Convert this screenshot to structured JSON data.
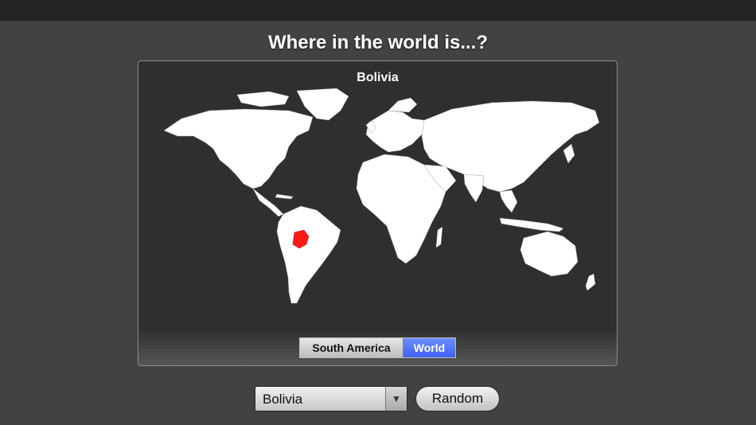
{
  "header": {
    "title": "Where in the world is...?"
  },
  "map_panel": {
    "country_label": "Bolivia",
    "highlight_color": "#ff1a1a",
    "land_color": "#ffffff",
    "ocean_color": "#2f2f2f",
    "regions": [
      {
        "label": "South America",
        "selected": false
      },
      {
        "label": "World",
        "selected": true
      }
    ]
  },
  "controls": {
    "country_select_value": "Bolivia",
    "random_label": "Random"
  },
  "colors": {
    "background": "#424242",
    "selected_segment": "#4a6cf7"
  },
  "icons": {
    "dropdown": "chevron-down-icon"
  }
}
